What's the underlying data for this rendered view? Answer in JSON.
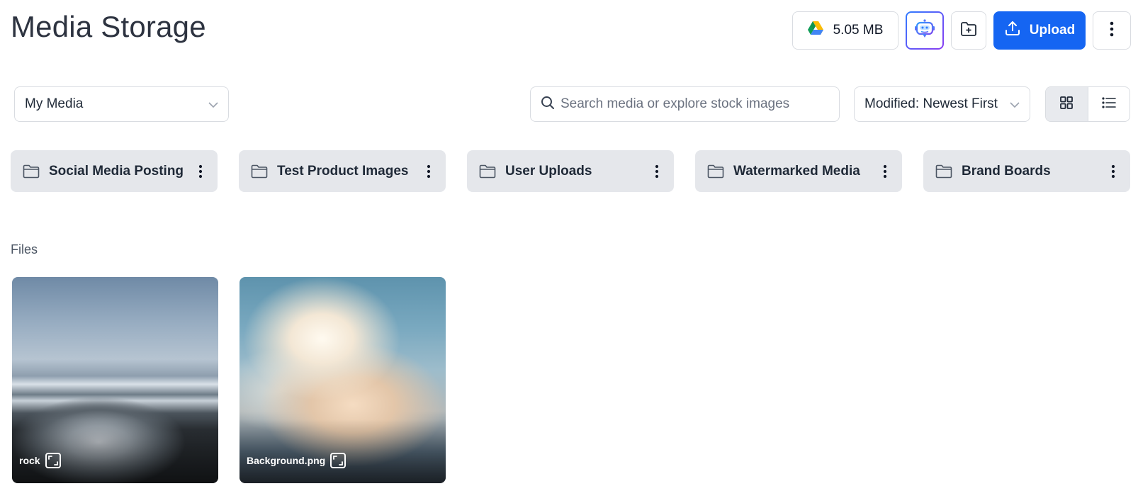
{
  "header": {
    "title": "Media Storage",
    "storage_label": "5.05 MB",
    "upload_label": "Upload"
  },
  "toolbar": {
    "media_select": "My Media",
    "search_placeholder": "Search media or explore stock images",
    "sort_select": "Modified: Newest First"
  },
  "folders": [
    {
      "name": "Social Media Posting"
    },
    {
      "name": "Test Product Images"
    },
    {
      "name": "User Uploads"
    },
    {
      "name": "Watermarked Media"
    },
    {
      "name": "Brand Boards"
    }
  ],
  "files_section": {
    "heading": "Files",
    "items": [
      {
        "name": "rock"
      },
      {
        "name": "Background.png"
      }
    ]
  },
  "colors": {
    "primary": "#1565f2",
    "folder_bg": "#e5e7eb",
    "border": "#d9dce1"
  },
  "icons": {
    "storage": "google-drive-icon",
    "ai": "robot-chat-icon",
    "new_folder": "folder-plus-icon",
    "upload": "upload-icon",
    "more": "kebab-vertical-icon",
    "search": "search-icon",
    "chevron": "chevron-down-icon",
    "grid_view": "grid-icon",
    "list_view": "list-icon",
    "folder": "folder-icon",
    "expand": "expand-icon"
  }
}
